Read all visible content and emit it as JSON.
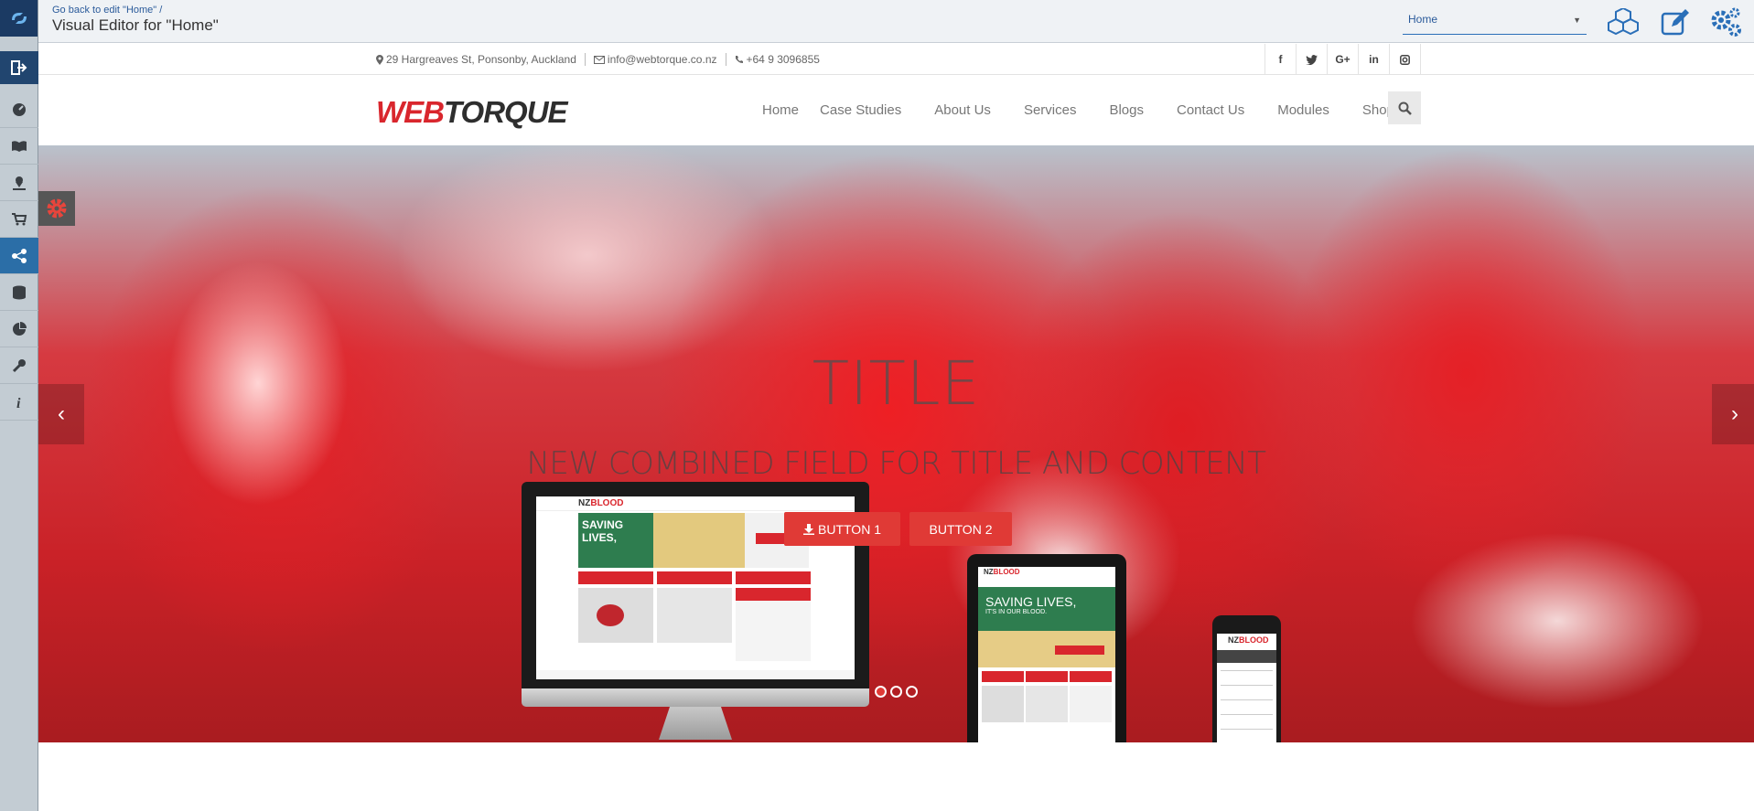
{
  "editor": {
    "breadcrumb_link": "Go back to edit \"Home\"",
    "breadcrumb_sep": "/",
    "title": "Visual Editor for \"Home\"",
    "page_select_value": "Home"
  },
  "rail": {
    "items": [
      {
        "icon": "dashboard-icon"
      },
      {
        "icon": "book-icon"
      },
      {
        "icon": "map-pin-icon"
      },
      {
        "icon": "cart-icon"
      },
      {
        "icon": "share-nodes-icon"
      },
      {
        "icon": "database-icon"
      },
      {
        "icon": "pie-chart-icon"
      },
      {
        "icon": "tools-icon"
      },
      {
        "icon": "info-icon"
      }
    ],
    "active_color": "#2b6ea7"
  },
  "site": {
    "info": {
      "address": "29 Hargreaves St, Ponsonby, Auckland",
      "email": "info@webtorque.co.nz",
      "phone": "+64 9 3096855"
    },
    "social": [
      "f",
      "t",
      "G+",
      "in",
      "ig"
    ],
    "brand": {
      "part1": "WEB",
      "part2": "TORQUE"
    },
    "menu": [
      "Home",
      "Case Studies",
      "About Us",
      "Services",
      "Blogs",
      "Contact Us",
      "Modules",
      "Shop"
    ],
    "hero": {
      "title": "TITLE",
      "subtitle": "NEW COMBINED FIELD FOR TITLE AND CONTENT",
      "button1": "BUTTON 1",
      "button2": "BUTTON 2",
      "prev": "‹",
      "next": "›",
      "slides_total": 3,
      "active_slide": 1
    },
    "mockup": {
      "logo_a": "NZ",
      "logo_b": "BLOOD",
      "headline": "SAVING LIVES,",
      "tagline": "IT'S IN OUR BLOOD."
    },
    "accent": "#e03a36",
    "brand_red": "#d9262d"
  }
}
